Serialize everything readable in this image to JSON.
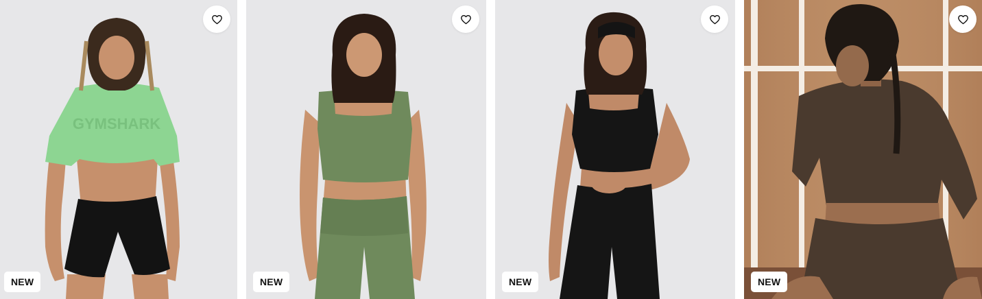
{
  "products": [
    {
      "badge": "NEW",
      "top_color": "#8dd592",
      "bottom_color": "#131313",
      "print": "GYMSHARK"
    },
    {
      "badge": "NEW",
      "top_color": "#6f8a5c",
      "bottom_color": "#6f8a5c"
    },
    {
      "badge": "NEW",
      "top_color": "#151515",
      "bottom_color": "#151515"
    },
    {
      "badge": "NEW",
      "top_color": "#4a3a2e",
      "bottom_color": "#4a3a2e"
    }
  ],
  "icons": {
    "wishlist": "heart-outline-icon"
  },
  "colors": {
    "studio_background": "#e7e7e9",
    "badge_background": "#ffffff",
    "badge_text": "#111111"
  }
}
